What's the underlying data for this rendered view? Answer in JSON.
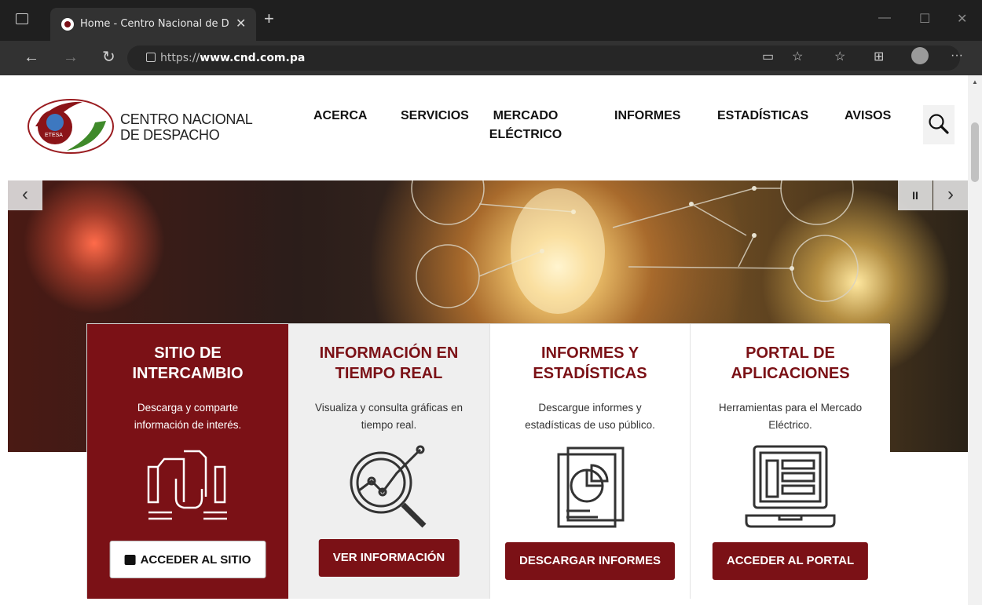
{
  "browser": {
    "tab_title": "Home - Centro Nacional de Despacho",
    "url_prefix": "https://",
    "url_domain": "www.cnd.com.pa"
  },
  "header": {
    "brand_line1": "CENTRO NACIONAL",
    "brand_line2": "DE DESPACHO",
    "logo_text": "ETESA",
    "menu": [
      {
        "label": "ACERCA"
      },
      {
        "label": "SERVICIOS"
      },
      {
        "label": "MERCADO ELÉCTRICO"
      },
      {
        "label": "INFORMES"
      },
      {
        "label": "ESTADÍSTICAS"
      },
      {
        "label": "AVISOS"
      }
    ]
  },
  "slider": {
    "prev": "‹",
    "next": "›",
    "pause": "II"
  },
  "cards": [
    {
      "title_1": "SITIO DE",
      "title_2": "INTERCAMBIO",
      "desc_1": "Descarga y comparte",
      "desc_2": "información de interés.",
      "button": "ACCEDER AL SITIO",
      "icon": "document-exchange-icon"
    },
    {
      "title_1": "INFORMACIÓN EN",
      "title_2": "TIEMPO REAL",
      "desc_1": "Visualiza y consulta gráficas en",
      "desc_2": "tiempo real.",
      "button": "VER INFORMACIÓN",
      "icon": "magnifier-chart-icon"
    },
    {
      "title_1": "INFORMES Y",
      "title_2": "ESTADÍSTICAS",
      "desc_1": "Descargue informes y",
      "desc_2": "estadísticas de uso público.",
      "button": "DESCARGAR INFORMES",
      "icon": "report-pie-chart-icon"
    },
    {
      "title_1": "PORTAL DE",
      "title_2": "APLICACIONES",
      "desc_1": "Herramientas para el Mercado",
      "desc_2": "Eléctrico.",
      "button": "ACCEDER AL PORTAL",
      "icon": "laptop-app-icon"
    }
  ],
  "colors": {
    "brand": "#7b1116",
    "card_bg_alt": "#efefef"
  }
}
